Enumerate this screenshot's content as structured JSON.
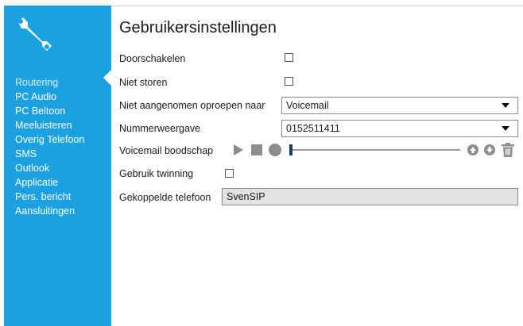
{
  "sidebar": {
    "items": [
      {
        "label": "Routering"
      },
      {
        "label": "PC Audio"
      },
      {
        "label": "PC Beltoon"
      },
      {
        "label": "Meeluisteren"
      },
      {
        "label": "Overig Telefoon"
      },
      {
        "label": "SMS"
      },
      {
        "label": "Outlook"
      },
      {
        "label": "Applicatie"
      },
      {
        "label": "Pers. bericht"
      },
      {
        "label": "Aansluitingen"
      }
    ],
    "active_index": 0,
    "color": "#1ba1e2",
    "icon": "wrench-icon"
  },
  "main": {
    "title": "Gebruikersinstellingen",
    "forwarding": {
      "label": "Doorschakelen",
      "checked": false
    },
    "dnd": {
      "label": "Niet storen",
      "checked": false
    },
    "unanswered": {
      "label": "Niet aangenomen oproepen naar",
      "value": "Voicemail"
    },
    "number_display": {
      "label": "Nummerweergave",
      "value": "0152511411"
    },
    "voicemail": {
      "label": "Voicemail boodschap",
      "progress": 0
    },
    "twinning": {
      "label": "Gebruik twinning",
      "checked": false
    },
    "linked_phone": {
      "label": "Gekoppelde telefoon",
      "value": "SvenSIP"
    }
  }
}
